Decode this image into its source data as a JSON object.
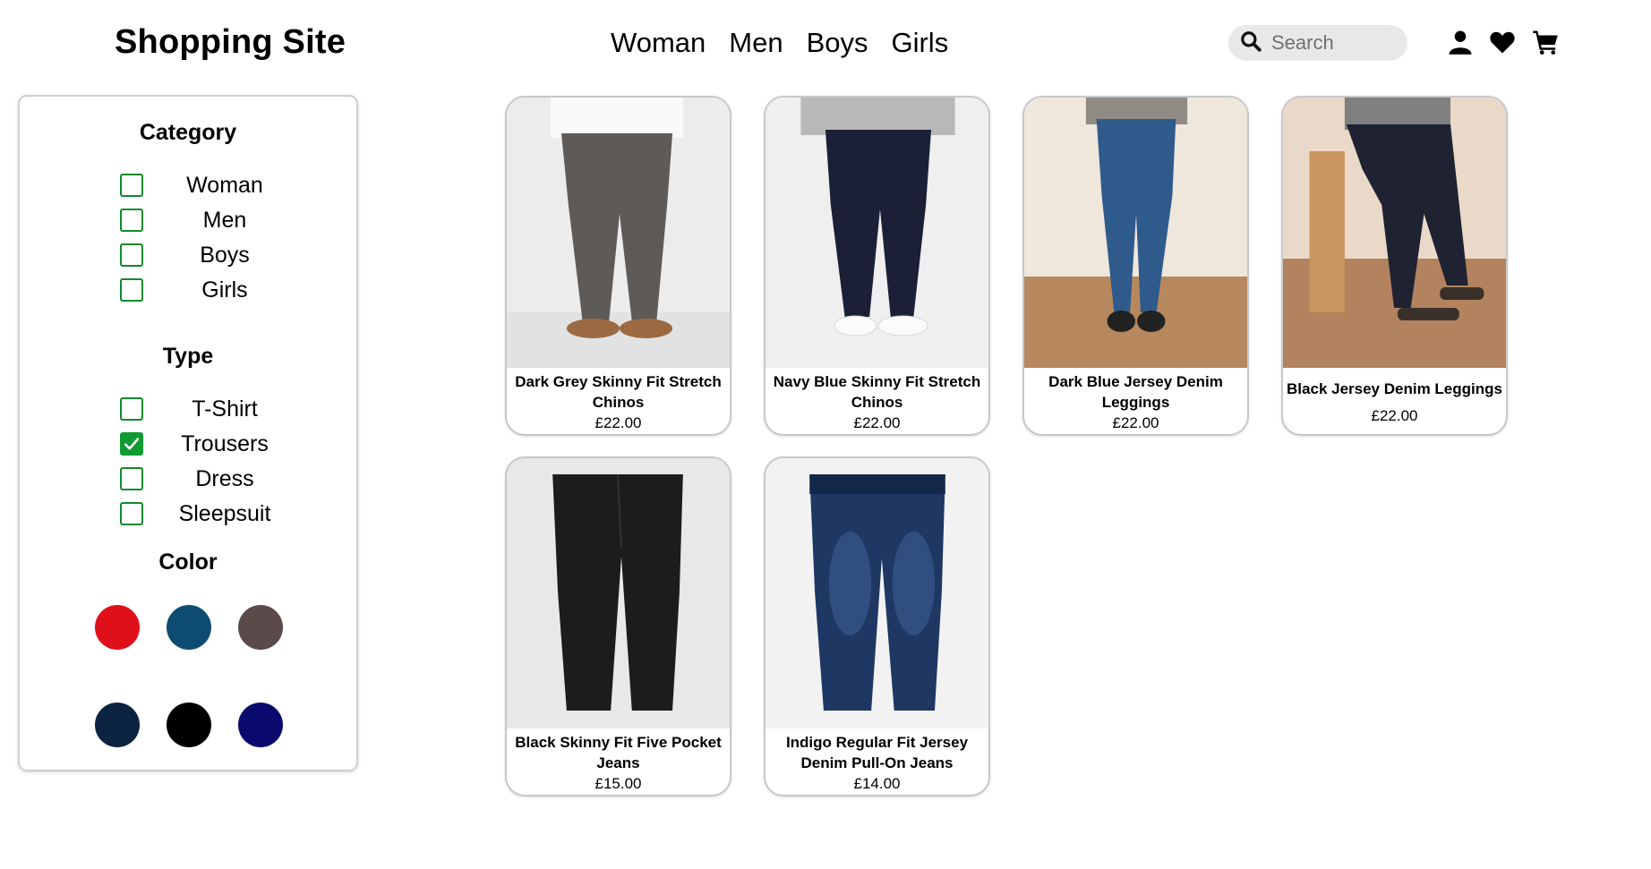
{
  "header": {
    "brand": "Shopping Site",
    "nav": [
      "Woman",
      "Men",
      "Boys",
      "Girls"
    ],
    "search_placeholder": "Search",
    "icons": [
      "search-icon",
      "user-icon",
      "heart-icon",
      "cart-icon"
    ]
  },
  "filters": {
    "category": {
      "title": "Category",
      "options": [
        {
          "label": "Woman",
          "checked": false
        },
        {
          "label": "Men",
          "checked": false
        },
        {
          "label": "Boys",
          "checked": false
        },
        {
          "label": "Girls",
          "checked": false
        }
      ]
    },
    "type": {
      "title": "Type",
      "options": [
        {
          "label": "T-Shirt",
          "checked": false
        },
        {
          "label": "Trousers",
          "checked": true
        },
        {
          "label": "Dress",
          "checked": false
        },
        {
          "label": "Sleepsuit",
          "checked": false
        }
      ]
    },
    "color": {
      "title": "Color",
      "swatches": [
        "#e0101a",
        "#0e4b72",
        "#5a4a4a",
        "#0b2240",
        "#000000",
        "#0a0a6e"
      ]
    }
  },
  "products": [
    {
      "name": "Dark Grey Skinny Fit Stretch Chinos",
      "price": "£22.00"
    },
    {
      "name": "Navy Blue Skinny Fit Stretch Chinos",
      "price": "£22.00"
    },
    {
      "name": "Dark Blue Jersey Denim Leggings",
      "price": "£22.00"
    },
    {
      "name": "Black Jersey Denim Leggings",
      "price": "£22.00"
    },
    {
      "name": "Black Skinny Fit Five Pocket Jeans",
      "price": "£15.00"
    },
    {
      "name": "Indigo Regular Fit Jersey Denim Pull-On Jeans",
      "price": "£14.00"
    }
  ],
  "colors": {
    "checkbox_border": "#0f8a2e",
    "checkbox_checked": "#0f9a32",
    "search_bg": "#e8e8e8"
  }
}
